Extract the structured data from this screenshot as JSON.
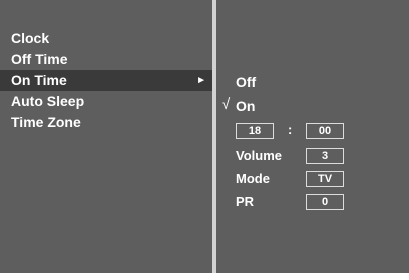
{
  "menu": {
    "items": [
      {
        "label": "Clock"
      },
      {
        "label": "Off Time"
      },
      {
        "label": "On Time",
        "arrow": "►"
      },
      {
        "label": "Auto Sleep"
      },
      {
        "label": "Time Zone"
      }
    ]
  },
  "submenu": {
    "off_label": "Off",
    "check_mark": "√",
    "on_label": "On",
    "hour": "18",
    "separator": ":",
    "minute": "00",
    "volume_label": "Volume",
    "volume_value": "3",
    "mode_label": "Mode",
    "mode_value": "TV",
    "pr_label": "PR",
    "pr_value": "0"
  },
  "colors": {
    "background": "#5e5e5e",
    "highlight": "#3a3a3a",
    "divider": "#d2d2d2",
    "text": "#ffffff"
  }
}
